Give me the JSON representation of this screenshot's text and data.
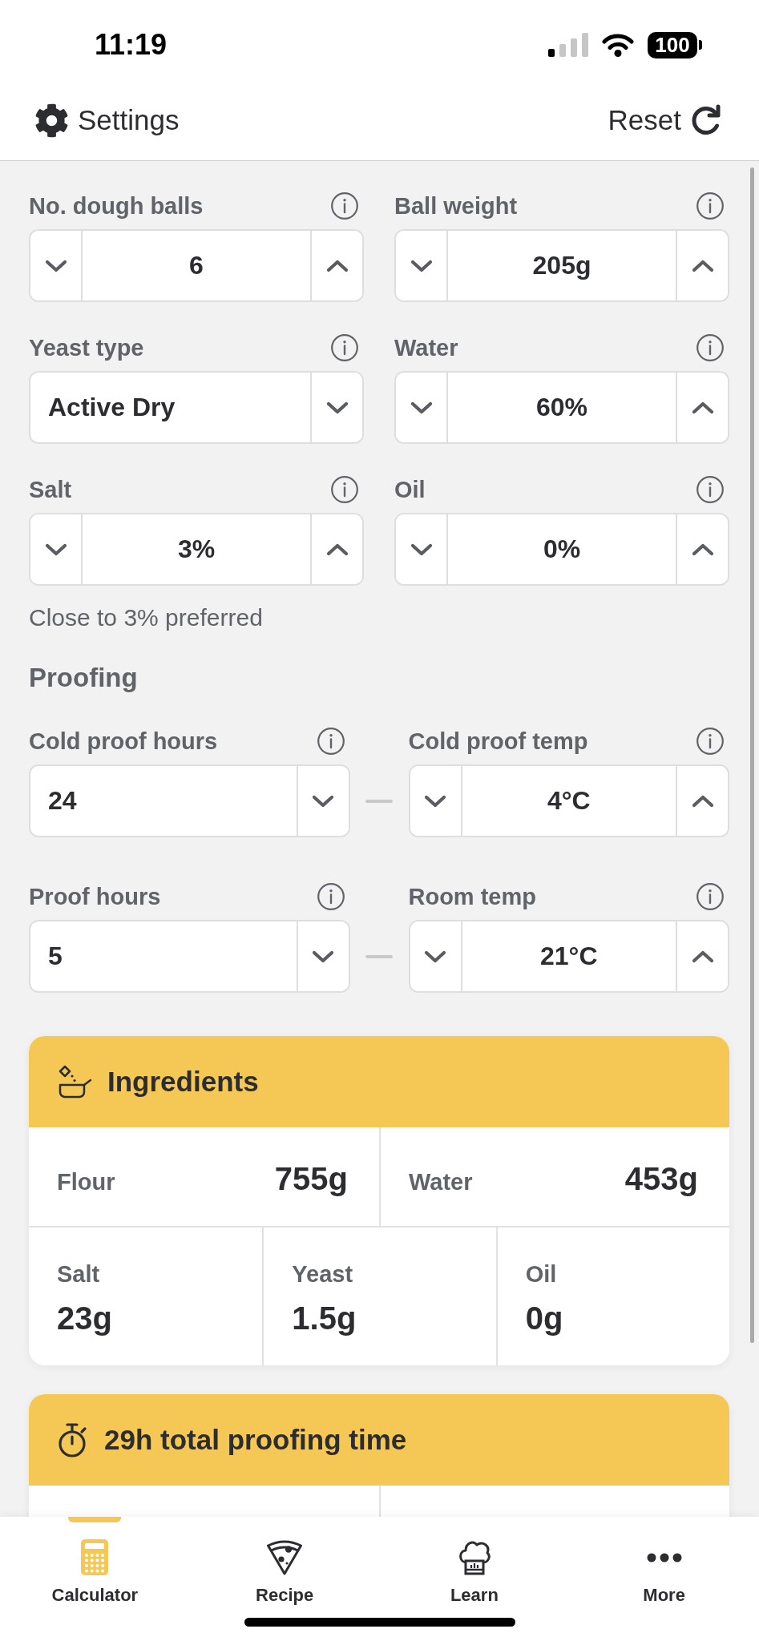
{
  "status_bar": {
    "time": "11:19",
    "battery": "100"
  },
  "header": {
    "settings": "Settings",
    "reset": "Reset"
  },
  "settings": [
    {
      "kind": "stepper",
      "label": "No. dough balls",
      "value": "6"
    },
    {
      "kind": "stepper",
      "label": "Ball weight",
      "value": "205g"
    },
    {
      "kind": "select",
      "label": "Yeast type",
      "value": "Active Dry"
    },
    {
      "kind": "stepper",
      "label": "Water",
      "value": "60%"
    },
    {
      "kind": "stepper",
      "label": "Salt",
      "value": "3%",
      "hint": "Close to 3% preferred"
    },
    {
      "kind": "stepper",
      "label": "Oil",
      "value": "0%"
    }
  ],
  "proofing": {
    "title": "Proofing",
    "rows": [
      {
        "fields": [
          {
            "kind": "select",
            "label": "Cold proof hours",
            "value": "24"
          },
          {
            "kind": "stepper",
            "label": "Cold proof temp",
            "value": "4°C"
          }
        ]
      },
      {
        "fields": [
          {
            "kind": "select",
            "label": "Proof hours",
            "value": "5"
          },
          {
            "kind": "stepper",
            "label": "Room temp",
            "value": "21°C"
          }
        ]
      }
    ]
  },
  "ingredients": {
    "title": "Ingredients",
    "rows": [
      {
        "kind": "inline",
        "items": [
          {
            "label": "Flour",
            "amount": "755g"
          },
          {
            "label": "Water",
            "amount": "453g"
          }
        ]
      },
      {
        "kind": "stacked",
        "items": [
          {
            "label": "Salt",
            "amount": "23g"
          },
          {
            "label": "Yeast",
            "amount": "1.5g"
          },
          {
            "label": "Oil",
            "amount": "0g"
          }
        ]
      }
    ]
  },
  "proofing_time": {
    "title": "29h total proofing time"
  },
  "tab_bar": [
    {
      "label": "Calculator",
      "selected": true
    },
    {
      "label": "Recipe",
      "selected": false
    },
    {
      "label": "Learn",
      "selected": false
    },
    {
      "label": "More",
      "selected": false
    }
  ]
}
